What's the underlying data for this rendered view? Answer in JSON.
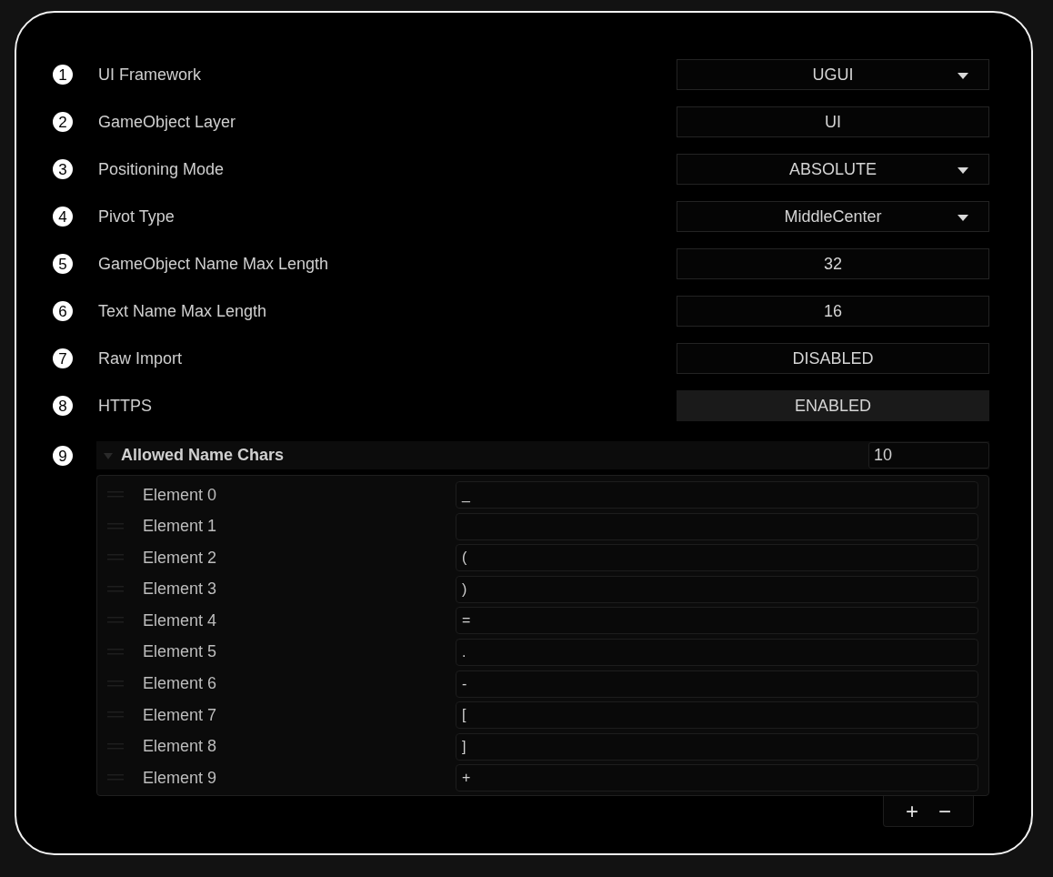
{
  "settings": [
    {
      "number": "1",
      "label": "UI Framework",
      "kind": "dropdown",
      "value": "UGUI"
    },
    {
      "number": "2",
      "label": "GameObject Layer",
      "kind": "field",
      "value": "UI"
    },
    {
      "number": "3",
      "label": "Positioning Mode",
      "kind": "dropdown",
      "value": "ABSOLUTE"
    },
    {
      "number": "4",
      "label": "Pivot Type",
      "kind": "dropdown",
      "value": "MiddleCenter"
    },
    {
      "number": "5",
      "label": "GameObject Name Max Length",
      "kind": "field",
      "value": "32"
    },
    {
      "number": "6",
      "label": "Text Name Max Length",
      "kind": "field",
      "value": "16"
    },
    {
      "number": "7",
      "label": "Raw Import",
      "kind": "toggle",
      "value": "DISABLED",
      "on": false
    },
    {
      "number": "8",
      "label": "HTTPS",
      "kind": "toggle",
      "value": "ENABLED",
      "on": true
    }
  ],
  "list": {
    "number": "9",
    "title": "Allowed Name Chars",
    "expanded": true,
    "count": "10",
    "elements": [
      {
        "label": "Element 0",
        "value": "_"
      },
      {
        "label": "Element 1"
      },
      {
        "label": "Element 2",
        "value": "("
      },
      {
        "label": "Element 3",
        "value": ")"
      },
      {
        "label": "Element 4",
        "value": "="
      },
      {
        "label": "Element 5",
        "value": "."
      },
      {
        "label": "Element 6",
        "value": "-"
      },
      {
        "label": "Element 7",
        "value": "["
      },
      {
        "label": "Element 8",
        "value": "]"
      },
      {
        "label": "Element 9",
        "value": "+"
      }
    ],
    "add_button": "+",
    "remove_button": "−"
  }
}
